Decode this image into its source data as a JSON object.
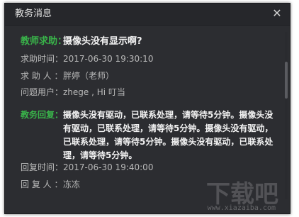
{
  "dialog": {
    "title": "教务消息",
    "close_glyph": "✕"
  },
  "message": {
    "help_label": "教师求助：",
    "help_text": "摄像头没有显示啊?",
    "fields": [
      {
        "label": "求助时间：",
        "value": "2017-06-30  19:30:10"
      },
      {
        "label": "求 助 人 ：",
        "value": "胖婷（老师）"
      },
      {
        "label": "问题用户：",
        "value": "zhege , Hi 叮当"
      }
    ],
    "reply_label": "教务回复：",
    "reply_text": "摄像头没有驱动，已联系处理，请等待5分钟。摄像头没有驱动，已联系处理，请等待5分钟。摄像头没有驱动，已联系处理，请等待5分钟。摄像头没有驱动，已联系处理，请等待5分钟。",
    "reply_fields": [
      {
        "label": "回复时间：",
        "value": "2017-06-30  19:40:00"
      },
      {
        "label": "回 复 人 ：",
        "value": "冻冻"
      }
    ]
  },
  "watermark": {
    "glyph": "下载吧",
    "url": "www.xiazaiba.com"
  },
  "colors": {
    "accent_green": "#39b54a",
    "background": "#2c2d31",
    "text_muted": "#b9b9b9",
    "text_bright": "#f2f2f2"
  }
}
